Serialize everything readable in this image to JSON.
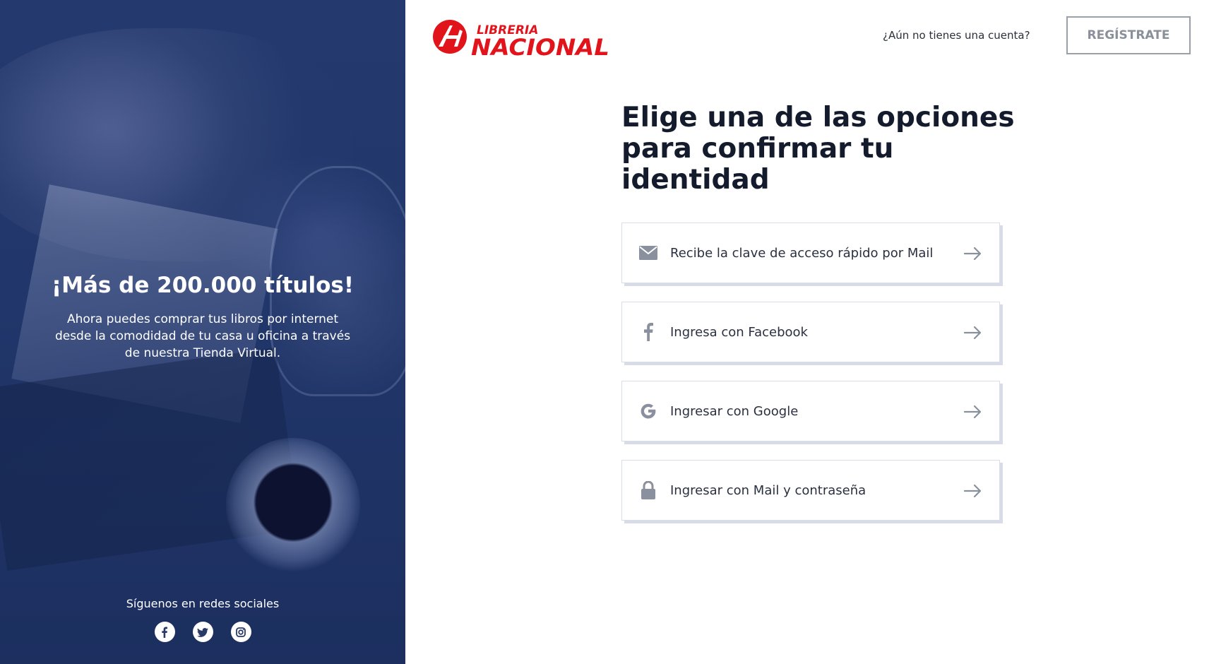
{
  "brand": {
    "logo_top": "LIBRERIA",
    "logo_bottom": "NACIONAL",
    "logo_color": "#e1141b"
  },
  "header": {
    "signup_question": "¿Aún no tienes una cuenta?",
    "signup_button": "REGÍSTRATE"
  },
  "promo": {
    "title": "¡Más de 200.000 títulos!",
    "text": "Ahora puedes comprar tus libros por internet desde la comodidad de tu casa u oficina a través de nuestra Tienda Virtual.",
    "social_label": "Síguenos en redes sociales",
    "social": [
      {
        "icon": "facebook-icon"
      },
      {
        "icon": "twitter-icon"
      },
      {
        "icon": "instagram-icon"
      }
    ],
    "panel_color": "#21366a"
  },
  "main": {
    "heading": "Elige una de las opciones para confirmar tu identidad",
    "options": [
      {
        "icon": "mail-icon",
        "label": "Recibe la clave de acceso rápido por Mail"
      },
      {
        "icon": "facebook-icon",
        "label": "Ingresa con Facebook"
      },
      {
        "icon": "google-icon",
        "label": "Ingresar con Google"
      },
      {
        "icon": "lock-icon",
        "label": "Ingresar con Mail y contraseña"
      }
    ],
    "icon_color": "#8a909e"
  }
}
